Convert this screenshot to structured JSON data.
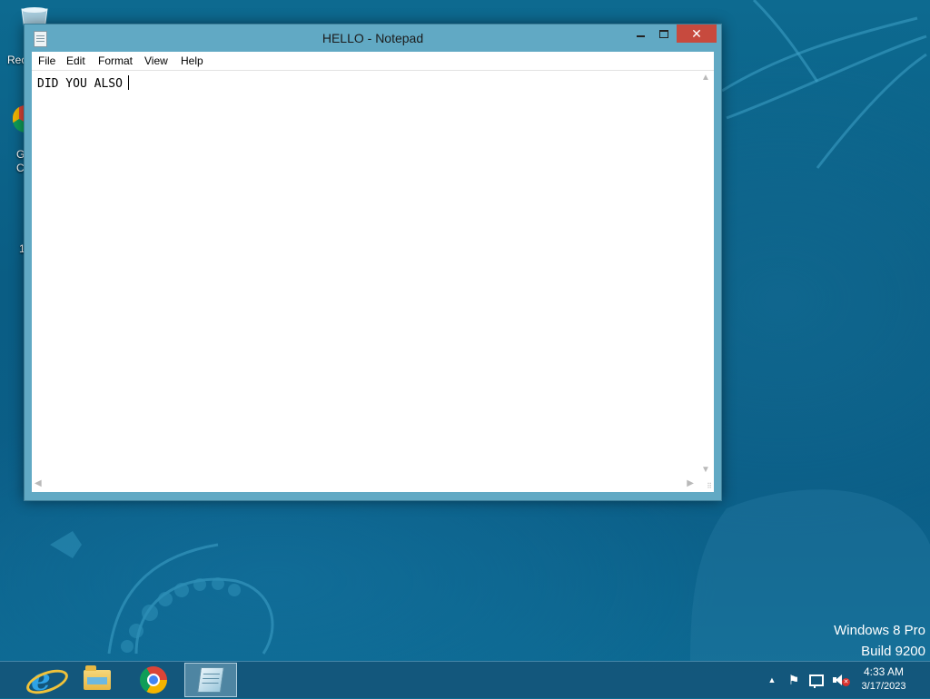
{
  "desktop": {
    "recycle_bin_label": "Rec",
    "fragment_g": "G",
    "fragment_c": "C",
    "fragment_1": "1"
  },
  "window": {
    "title": "HELLO - Notepad",
    "controls": {
      "minimize": "",
      "maximize": "",
      "close": "✕"
    },
    "menu": [
      "File",
      "Edit",
      "Format",
      "View",
      "Help"
    ],
    "content": "DID YOU ALSO"
  },
  "watermark": {
    "line1": "Windows 8 Pro",
    "line2": "Build 9200"
  },
  "taskbar": {
    "apps": [
      {
        "name": "Internet Explorer",
        "icon": "internet-explorer-icon"
      },
      {
        "name": "File Explorer",
        "icon": "folder-icon"
      },
      {
        "name": "Google Chrome",
        "icon": "chrome-icon"
      },
      {
        "name": "Notepad",
        "icon": "notepad-icon",
        "active": true
      }
    ],
    "tray": {
      "show_hidden": "▲",
      "flag": "⚑"
    },
    "clock": {
      "time": "4:33 AM",
      "date": "3/17/2023"
    }
  },
  "colors": {
    "titlebar": "#61a9c4",
    "close_button": "#c74a3e",
    "desktop": "#0b5e87",
    "taskbar": "#14567a"
  }
}
